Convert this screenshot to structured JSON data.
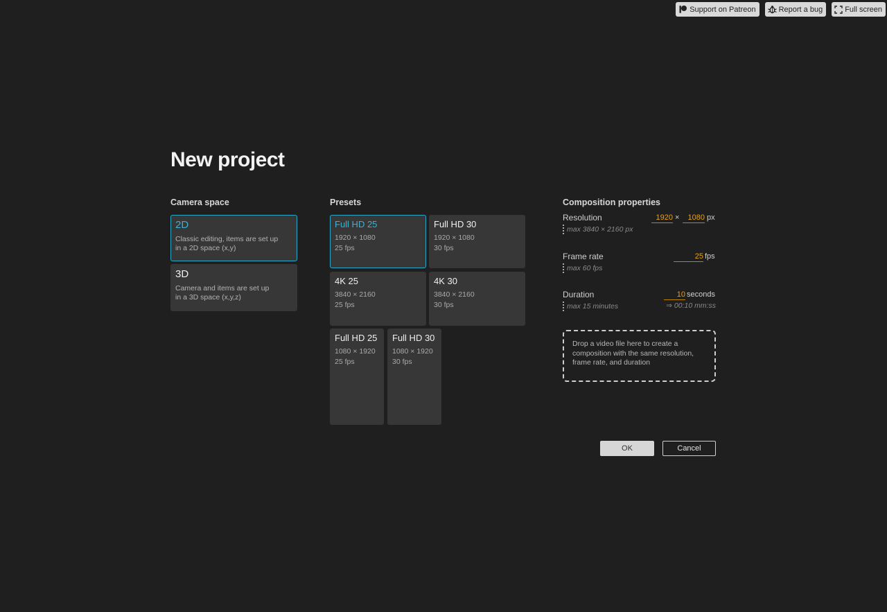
{
  "topbar": {
    "patreon_label": "Support on Patreon",
    "bug_label": "Report a bug",
    "fullscreen_label": "Full screen"
  },
  "title": "New project",
  "camera_space": {
    "heading": "Camera space",
    "options": [
      {
        "title": "2D",
        "line1": "Classic editing, items are set up",
        "line2": "in a 2D space (x,y)",
        "selected": true
      },
      {
        "title": "3D",
        "line1": "Camera and items are set up",
        "line2": "in a 3D space (x,y,z)",
        "selected": false
      }
    ]
  },
  "presets": {
    "heading": "Presets",
    "items": [
      {
        "title": "Full HD 25",
        "resolution": "1920 × 1080",
        "fps": "25 fps",
        "selected": true
      },
      {
        "title": "Full HD 30",
        "resolution": "1920 × 1080",
        "fps": "30 fps",
        "selected": false
      },
      {
        "title": "4K 25",
        "resolution": "3840 × 2160",
        "fps": "25 fps",
        "selected": false
      },
      {
        "title": "4K 30",
        "resolution": "3840 × 2160",
        "fps": "30 fps",
        "selected": false
      },
      {
        "title": "Full HD 25",
        "resolution": "1080 × 1920",
        "fps": "25 fps",
        "selected": false
      },
      {
        "title": "Full HD 30",
        "resolution": "1080 × 1920",
        "fps": "30 fps",
        "selected": false
      }
    ]
  },
  "composition": {
    "heading": "Composition properties",
    "resolution": {
      "label": "Resolution",
      "width": "1920",
      "times": "×",
      "height": "1080",
      "unit": "px",
      "hint": "max 3840 × 2160 px"
    },
    "frame_rate": {
      "label": "Frame rate",
      "value": "25",
      "unit": "fps",
      "hint": "max 60 fps"
    },
    "duration": {
      "label": "Duration",
      "value": "10",
      "unit": "seconds",
      "hint": "max 15 minutes",
      "derived": "⇒ 00:10 mm:ss"
    },
    "dropzone": {
      "line1": "Drop a video file here to create a",
      "line2": "composition with the same resolution,",
      "line3": "frame rate, and duration"
    }
  },
  "actions": {
    "ok_label": "OK",
    "cancel_label": "Cancel"
  },
  "colors": {
    "background": "#1f1f1f",
    "accent": "#2aa7c9",
    "value": "#f0a000"
  }
}
